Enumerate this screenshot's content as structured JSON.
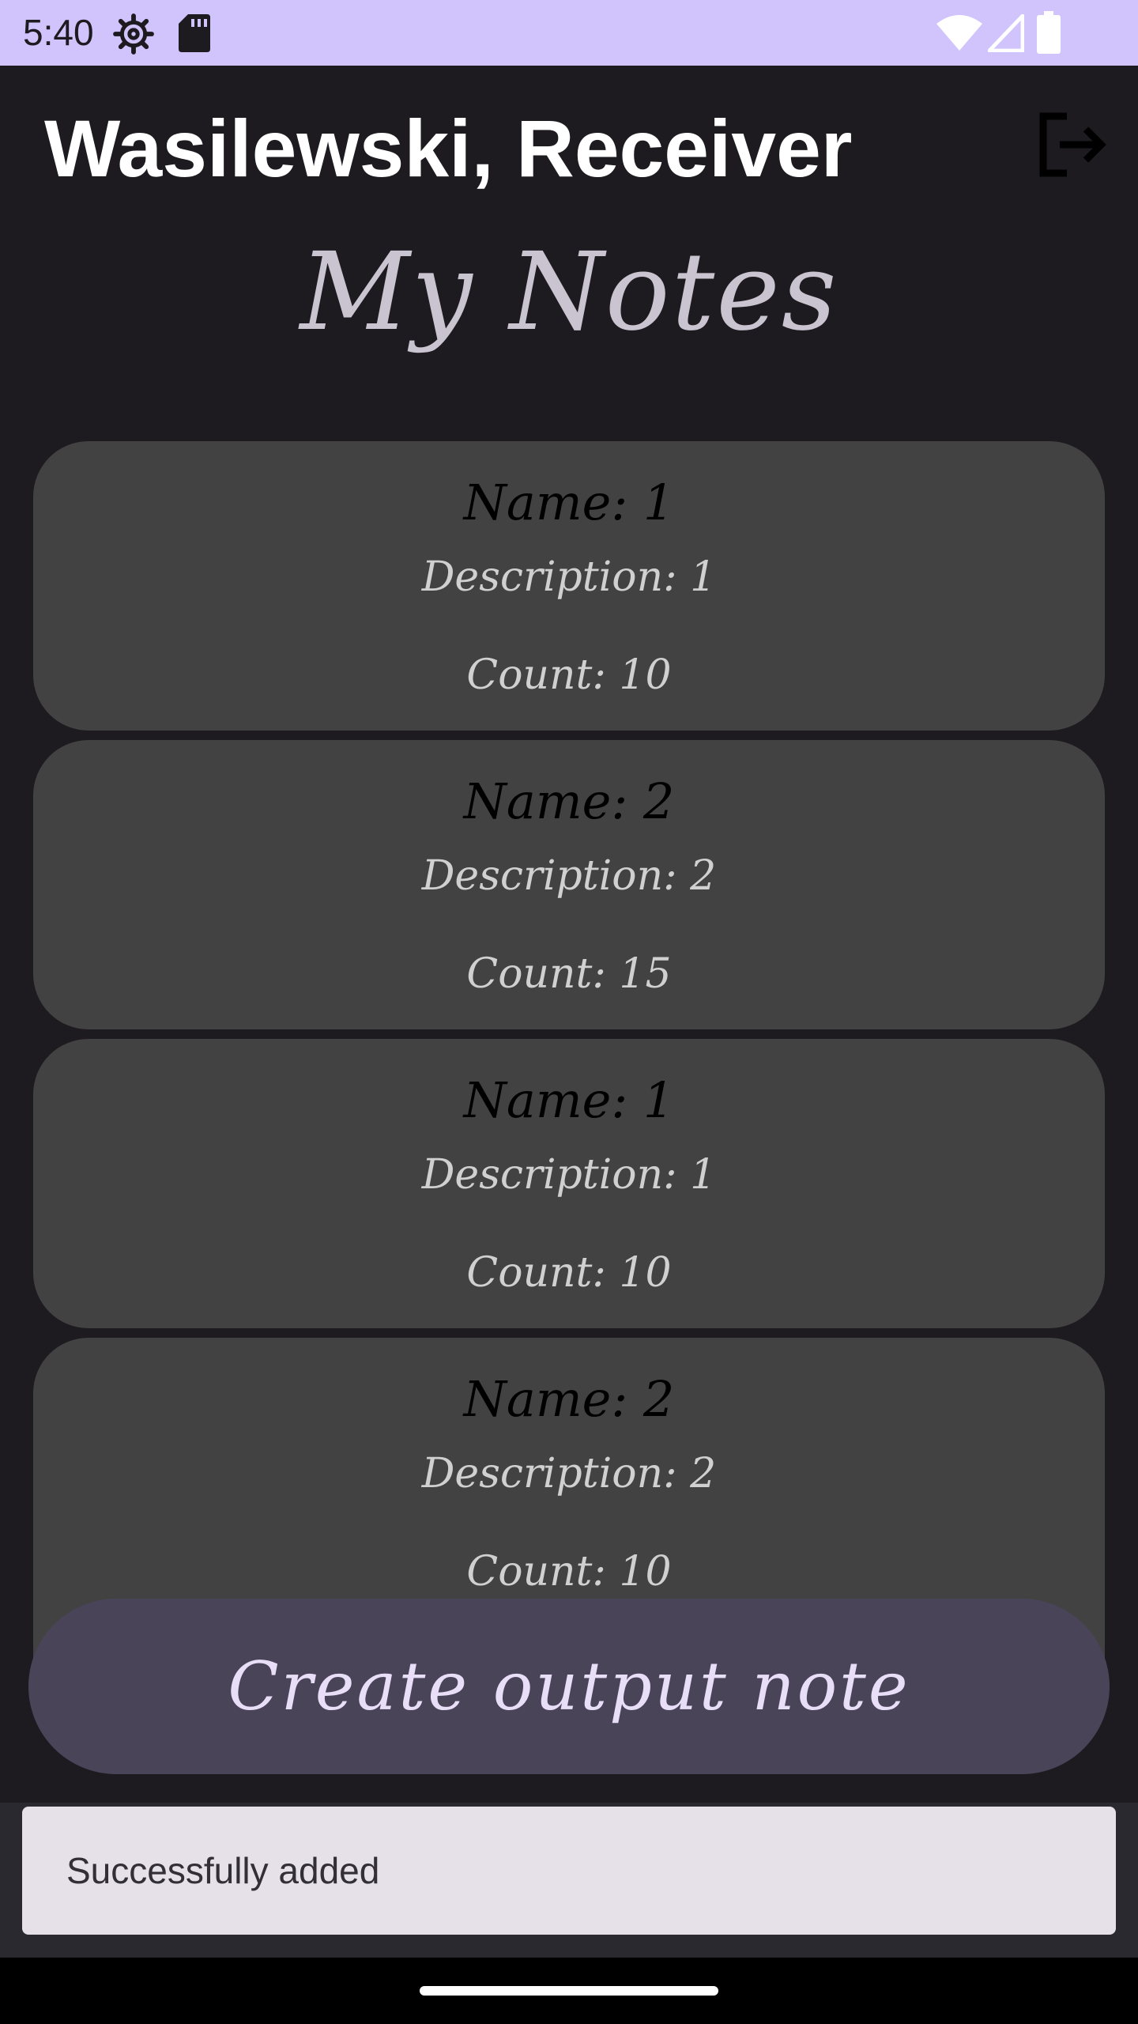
{
  "status_bar": {
    "time": "5:40",
    "left_icons": [
      "settings-gear-icon",
      "sd-card-icon"
    ],
    "right_icons": [
      "wifi-icon",
      "cell-signal-icon",
      "battery-icon"
    ],
    "background": "#d1c3fb"
  },
  "header": {
    "title": "Wasilewski, Receiver",
    "logout_icon": "logout-icon"
  },
  "page": {
    "title": "My Notes"
  },
  "notes": [
    {
      "name": "Name: 1",
      "description": "Description: 1",
      "count": "Count: 10"
    },
    {
      "name": "Name: 2",
      "description": "Description: 2",
      "count": "Count: 15"
    },
    {
      "name": "Name: 1",
      "description": "Description: 1",
      "count": "Count: 10"
    },
    {
      "name": "Name: 2",
      "description": "Description: 2",
      "count": "Count: 10"
    }
  ],
  "actions": {
    "create_label": "Create output note"
  },
  "snackbar": {
    "message": "Successfully added"
  },
  "colors": {
    "background": "#1d1b20",
    "card": "#424242",
    "button": "#4a4458",
    "snackbar": "#e6e0e9"
  }
}
